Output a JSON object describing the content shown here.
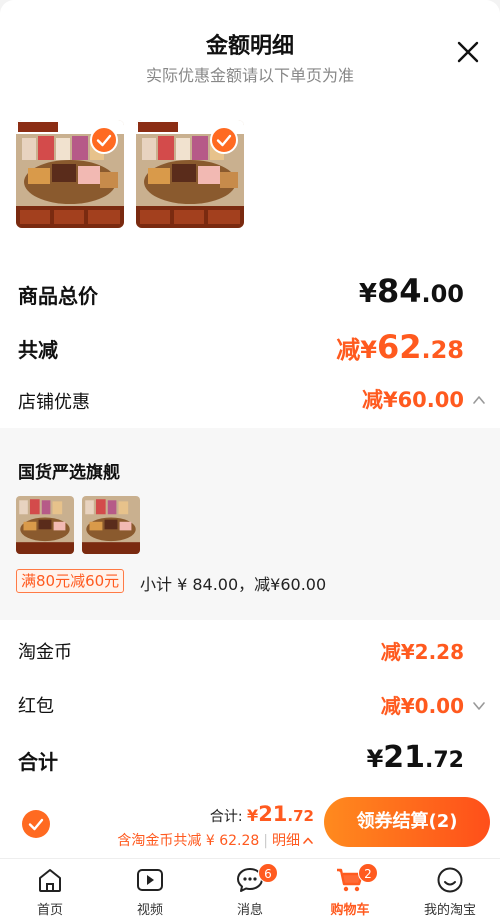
{
  "header": {
    "title": "金额明细",
    "subtitle": "实际优惠金额请以下单页为准"
  },
  "summary": {
    "total_label": "商品总价",
    "total_symbol": "¥",
    "total_int": "84",
    "total_dec": ".00",
    "reduce_label": "共减",
    "reduce_prefix": "减¥",
    "reduce_int": "62",
    "reduce_dec": ".28",
    "shop_discount_label": "店铺优惠",
    "shop_discount_value": "减¥60.00"
  },
  "store": {
    "name": "国货严选旗舰",
    "promo_tag": "满80元减60元",
    "promo_text": "小计 ¥ 84.00，减¥60.00"
  },
  "coins": {
    "label": "淘金币",
    "value": "减¥2.28"
  },
  "redpacket": {
    "label": "红包",
    "value": "减¥0.00"
  },
  "grand": {
    "label": "合计",
    "symbol": "¥",
    "int": "21",
    "dec": ".72"
  },
  "footer": {
    "sum_label": "合计: ",
    "sum_symbol": "¥",
    "sum_int": "21",
    "sum_dec": ".72",
    "discount_text": "含淘金币共减 ¥ 62.28",
    "detail_label": "明细",
    "checkout_label": "领券结算(2)"
  },
  "tabs": [
    {
      "label": "首页",
      "icon": "home-icon"
    },
    {
      "label": "视频",
      "icon": "video-icon"
    },
    {
      "label": "消息",
      "icon": "message-icon",
      "badge": "6"
    },
    {
      "label": "购物车",
      "icon": "cart-icon",
      "badge": "2",
      "active": true
    },
    {
      "label": "我的淘宝",
      "icon": "smile-icon"
    }
  ],
  "colors": {
    "accent": "#ff5a1f",
    "accent_light": "#ff8a1e"
  }
}
